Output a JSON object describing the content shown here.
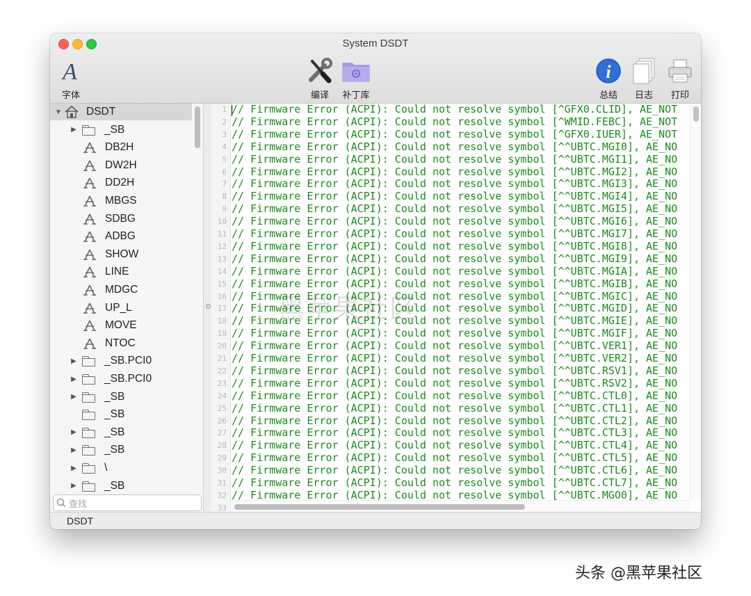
{
  "window": {
    "title": "System DSDT"
  },
  "toolbar": {
    "font_label": "字体",
    "compile_label": "编译",
    "patch_label": "补丁库",
    "summary_label": "总结",
    "log_label": "日志",
    "print_label": "打印"
  },
  "sidebar": {
    "root": "DSDT",
    "items": [
      {
        "kind": "folder",
        "label": "_SB",
        "expandable": true
      },
      {
        "kind": "method",
        "label": "DB2H"
      },
      {
        "kind": "method",
        "label": "DW2H"
      },
      {
        "kind": "method",
        "label": "DD2H"
      },
      {
        "kind": "method",
        "label": "MBGS"
      },
      {
        "kind": "method",
        "label": "SDBG"
      },
      {
        "kind": "method",
        "label": "ADBG"
      },
      {
        "kind": "method",
        "label": "SHOW"
      },
      {
        "kind": "method",
        "label": "LINE"
      },
      {
        "kind": "method",
        "label": "MDGC"
      },
      {
        "kind": "method",
        "label": "UP_L"
      },
      {
        "kind": "method",
        "label": "MOVE"
      },
      {
        "kind": "method",
        "label": "NTOC"
      },
      {
        "kind": "folder",
        "label": "_SB.PCI0",
        "expandable": true
      },
      {
        "kind": "folder",
        "label": "_SB.PCI0",
        "expandable": true
      },
      {
        "kind": "folder",
        "label": "_SB",
        "expandable": true
      },
      {
        "kind": "folder",
        "label": "_SB",
        "expandable": false
      },
      {
        "kind": "folder",
        "label": "_SB",
        "expandable": true
      },
      {
        "kind": "folder",
        "label": "_SB",
        "expandable": true
      },
      {
        "kind": "folder",
        "label": "\\",
        "expandable": true
      },
      {
        "kind": "folder",
        "label": "_SB",
        "expandable": true
      }
    ],
    "search_placeholder": "查找"
  },
  "editor": {
    "line_numbers": [
      "1",
      "2",
      "3",
      "4",
      "5",
      "6",
      "7",
      "8",
      "9",
      "10",
      "11",
      "12",
      "13",
      "14",
      "15",
      "16",
      "17",
      "18",
      "19",
      "20",
      "21",
      "22",
      "23",
      "24",
      "25",
      "26",
      "27",
      "28",
      "29",
      "30",
      "31",
      "32",
      "33"
    ],
    "lines": [
      "// Firmware Error (ACPI): Could not resolve symbol [^GFX0.CLID], AE_NOT",
      "// Firmware Error (ACPI): Could not resolve symbol [^WMID.FEBC], AE_NOT",
      "// Firmware Error (ACPI): Could not resolve symbol [^GFX0.IUER], AE_NOT",
      "// Firmware Error (ACPI): Could not resolve symbol [^^UBTC.MGI0], AE_NO",
      "// Firmware Error (ACPI): Could not resolve symbol [^^UBTC.MGI1], AE_NO",
      "// Firmware Error (ACPI): Could not resolve symbol [^^UBTC.MGI2], AE_NO",
      "// Firmware Error (ACPI): Could not resolve symbol [^^UBTC.MGI3], AE_NO",
      "// Firmware Error (ACPI): Could not resolve symbol [^^UBTC.MGI4], AE_NO",
      "// Firmware Error (ACPI): Could not resolve symbol [^^UBTC.MGI5], AE_NO",
      "// Firmware Error (ACPI): Could not resolve symbol [^^UBTC.MGI6], AE_NO",
      "// Firmware Error (ACPI): Could not resolve symbol [^^UBTC.MGI7], AE_NO",
      "// Firmware Error (ACPI): Could not resolve symbol [^^UBTC.MGI8], AE_NO",
      "// Firmware Error (ACPI): Could not resolve symbol [^^UBTC.MGI9], AE_NO",
      "// Firmware Error (ACPI): Could not resolve symbol [^^UBTC.MGIA], AE_NO",
      "// Firmware Error (ACPI): Could not resolve symbol [^^UBTC.MGIB], AE_NO",
      "// Firmware Error (ACPI): Could not resolve symbol [^^UBTC.MGIC], AE_NO",
      "// Firmware Error (ACPI): Could not resolve symbol [^^UBTC.MGID], AE_NO",
      "// Firmware Error (ACPI): Could not resolve symbol [^^UBTC.MGIE], AE_NO",
      "// Firmware Error (ACPI): Could not resolve symbol [^^UBTC.MGIF], AE_NO",
      "// Firmware Error (ACPI): Could not resolve symbol [^^UBTC.VER1], AE_NO",
      "// Firmware Error (ACPI): Could not resolve symbol [^^UBTC.VER2], AE_NO",
      "// Firmware Error (ACPI): Could not resolve symbol [^^UBTC.RSV1], AE_NO",
      "// Firmware Error (ACPI): Could not resolve symbol [^^UBTC.RSV2], AE_NO",
      "// Firmware Error (ACPI): Could not resolve symbol [^^UBTC.CTL0], AE_NO",
      "// Firmware Error (ACPI): Could not resolve symbol [^^UBTC.CTL1], AE_NO",
      "// Firmware Error (ACPI): Could not resolve symbol [^^UBTC.CTL2], AE_NO",
      "// Firmware Error (ACPI): Could not resolve symbol [^^UBTC.CTL3], AE_NO",
      "// Firmware Error (ACPI): Could not resolve symbol [^^UBTC.CTL4], AE_NO",
      "// Firmware Error (ACPI): Could not resolve symbol [^^UBTC.CTL5], AE_NO",
      "// Firmware Error (ACPI): Could not resolve symbol [^^UBTC.CTL6], AE_NO",
      "// Firmware Error (ACPI): Could not resolve symbol [^^UBTC.CTL7], AE_NO",
      "// Firmware Error (ACPI): Could not resolve symbol [^^UBTC.MGO0], AE_NO"
    ]
  },
  "statusbar": {
    "text": "DSDT"
  },
  "watermark": {
    "text": "黑苹果社区"
  },
  "credit": {
    "text": "头条 @黑苹果社区"
  },
  "colors": {
    "code_text": "#1a8c1a",
    "info_blue": "#2f6fd8",
    "selection_gray": "#d7d7d7"
  },
  "icons": {
    "font": "font-A-icon",
    "compile": "wrench-screwdriver-icon",
    "patch": "purple-folder-gear-icon",
    "summary": "info-icon",
    "log": "documents-icon",
    "print": "printer-icon",
    "tree_root": "house-icon",
    "tree_folder": "folder-icon",
    "tree_method": "method-icon"
  }
}
